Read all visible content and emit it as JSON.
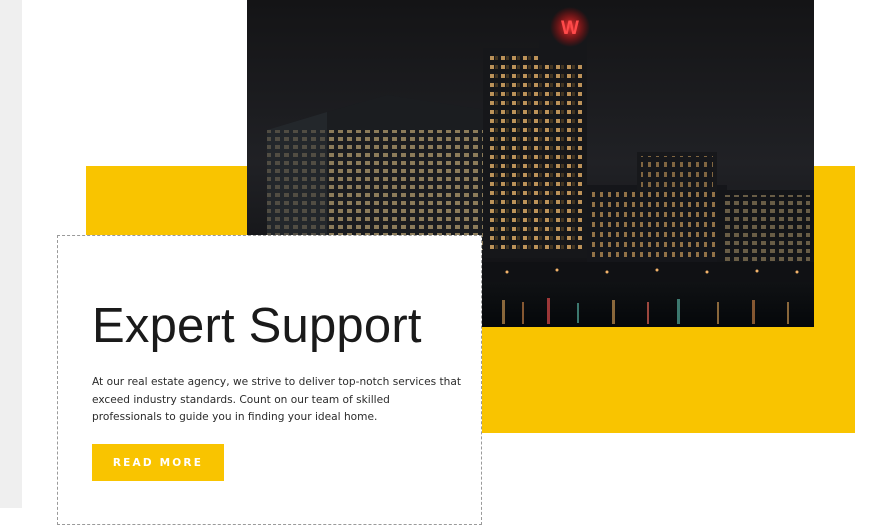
{
  "colors": {
    "accent": "#f9c400",
    "text": "#1a1a1a",
    "body_text": "#2b2b2b",
    "button_text": "#ffffff",
    "rail": "#efefef"
  },
  "hero_image": {
    "icon": "night-city-skyline-image",
    "sign_letter": "W"
  },
  "card": {
    "title": "Expert Support",
    "description": "At our real estate agency, we strive to deliver top-notch services that exceed industry standards. Count on our team of skilled professionals to guide you in finding your ideal home.",
    "button_label": "READ MORE"
  }
}
